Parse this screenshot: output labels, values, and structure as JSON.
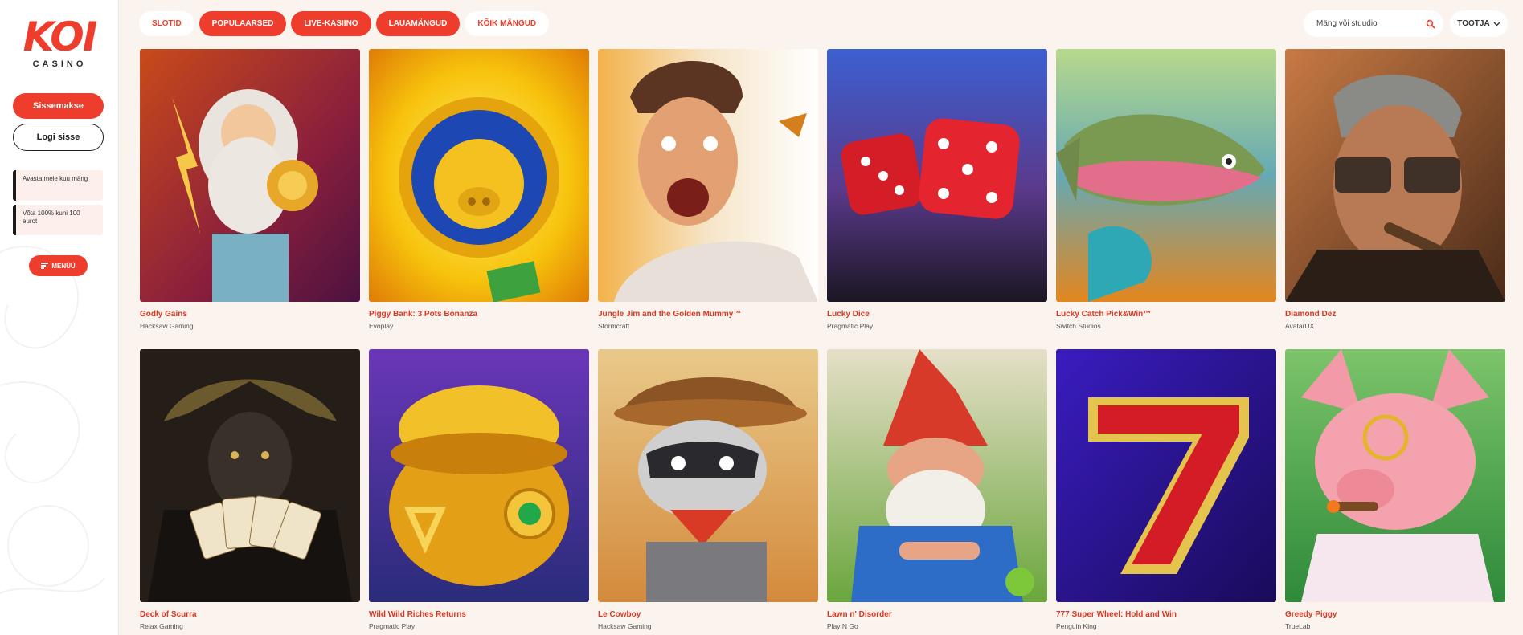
{
  "brand": {
    "logo": "KOI",
    "sub": "CASINO",
    "color": "#ee3d2c"
  },
  "sidebar": {
    "deposit_label": "Sissemakse",
    "login_label": "Logi sisse",
    "promos": [
      "Avasta meie kuu mäng",
      "Võta 100% kuni 100 eurot"
    ],
    "menu_label": "MENÜÜ"
  },
  "nav": {
    "tabs": [
      {
        "label": "SLOTID",
        "active": false
      },
      {
        "label": "POPULAARSED",
        "active": true
      },
      {
        "label": "LIVE-KASIINO",
        "active": true
      },
      {
        "label": "LAUAMÄNGUD",
        "active": true
      },
      {
        "label": "KÕIK MÄNGUD",
        "active": false
      }
    ],
    "search_placeholder": "Mäng või stuudio",
    "search_icon": "search-icon",
    "provider_label": "TOOTJA",
    "provider_icon": "chevron-down-icon"
  },
  "games": [
    {
      "title": "Godly Gains",
      "provider": "Hacksaw Gaming",
      "art": "zeus"
    },
    {
      "title": "Piggy Bank: 3 Pots Bonanza",
      "provider": "Evoplay",
      "art": "pig-coin"
    },
    {
      "title": "Jungle Jim and the Golden Mummy™",
      "provider": "Stormcraft",
      "art": "explorer"
    },
    {
      "title": "Lucky Dice",
      "provider": "Pragmatic Play",
      "art": "dice"
    },
    {
      "title": "Lucky Catch Pick&Win™",
      "provider": "Switch Studios",
      "art": "fish"
    },
    {
      "title": "Diamond Dez",
      "provider": "AvatarUX",
      "art": "mobster"
    },
    {
      "title": "Deck of Scurra",
      "provider": "Relax Gaming",
      "art": "jester"
    },
    {
      "title": "Wild Wild Riches Returns",
      "provider": "Pragmatic Play",
      "art": "pot-of-gold"
    },
    {
      "title": "Le Cowboy",
      "provider": "Hacksaw Gaming",
      "art": "raccoon"
    },
    {
      "title": "Lawn n' Disorder",
      "provider": "Play N Go",
      "art": "gnome"
    },
    {
      "title": "777 Super Wheel: Hold and Win",
      "provider": "Penguin King",
      "art": "seven"
    },
    {
      "title": "Greedy Piggy",
      "provider": "TrueLab",
      "art": "greedy-pig"
    }
  ]
}
